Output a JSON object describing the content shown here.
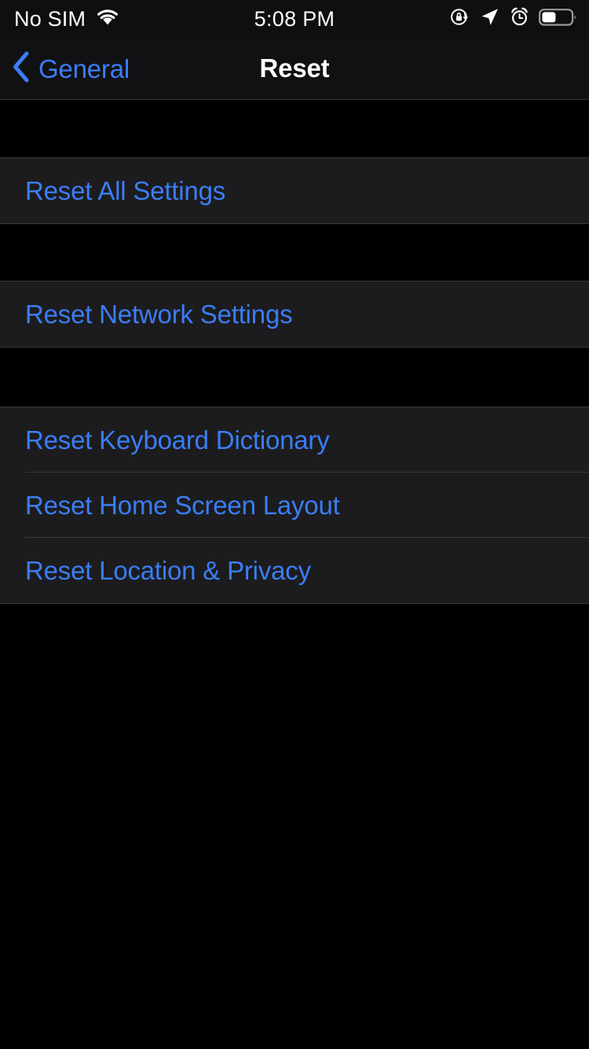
{
  "status_bar": {
    "carrier": "No SIM",
    "wifi_icon": "wifi-icon",
    "time": "5:08 PM",
    "rotation_lock_icon": "rotation-lock-icon",
    "location_icon": "location-arrow-icon",
    "alarm_icon": "alarm-clock-icon",
    "battery_icon": "battery-icon",
    "battery_level_percent": 45
  },
  "nav_bar": {
    "back_icon": "chevron-left-icon",
    "back_label": "General",
    "title": "Reset"
  },
  "colors": {
    "accent_blue": "#3b7df6",
    "cell_background": "#1c1c1e",
    "page_background": "#000000",
    "separator": "#38383a",
    "nav_background": "#111113",
    "title_text": "#ffffff"
  },
  "groups": [
    {
      "cells": [
        {
          "label": "Reset All Settings"
        }
      ]
    },
    {
      "cells": [
        {
          "label": "Reset Network Settings"
        }
      ]
    },
    {
      "cells": [
        {
          "label": "Reset Keyboard Dictionary"
        },
        {
          "label": "Reset Home Screen Layout"
        },
        {
          "label": "Reset Location & Privacy"
        }
      ]
    }
  ]
}
